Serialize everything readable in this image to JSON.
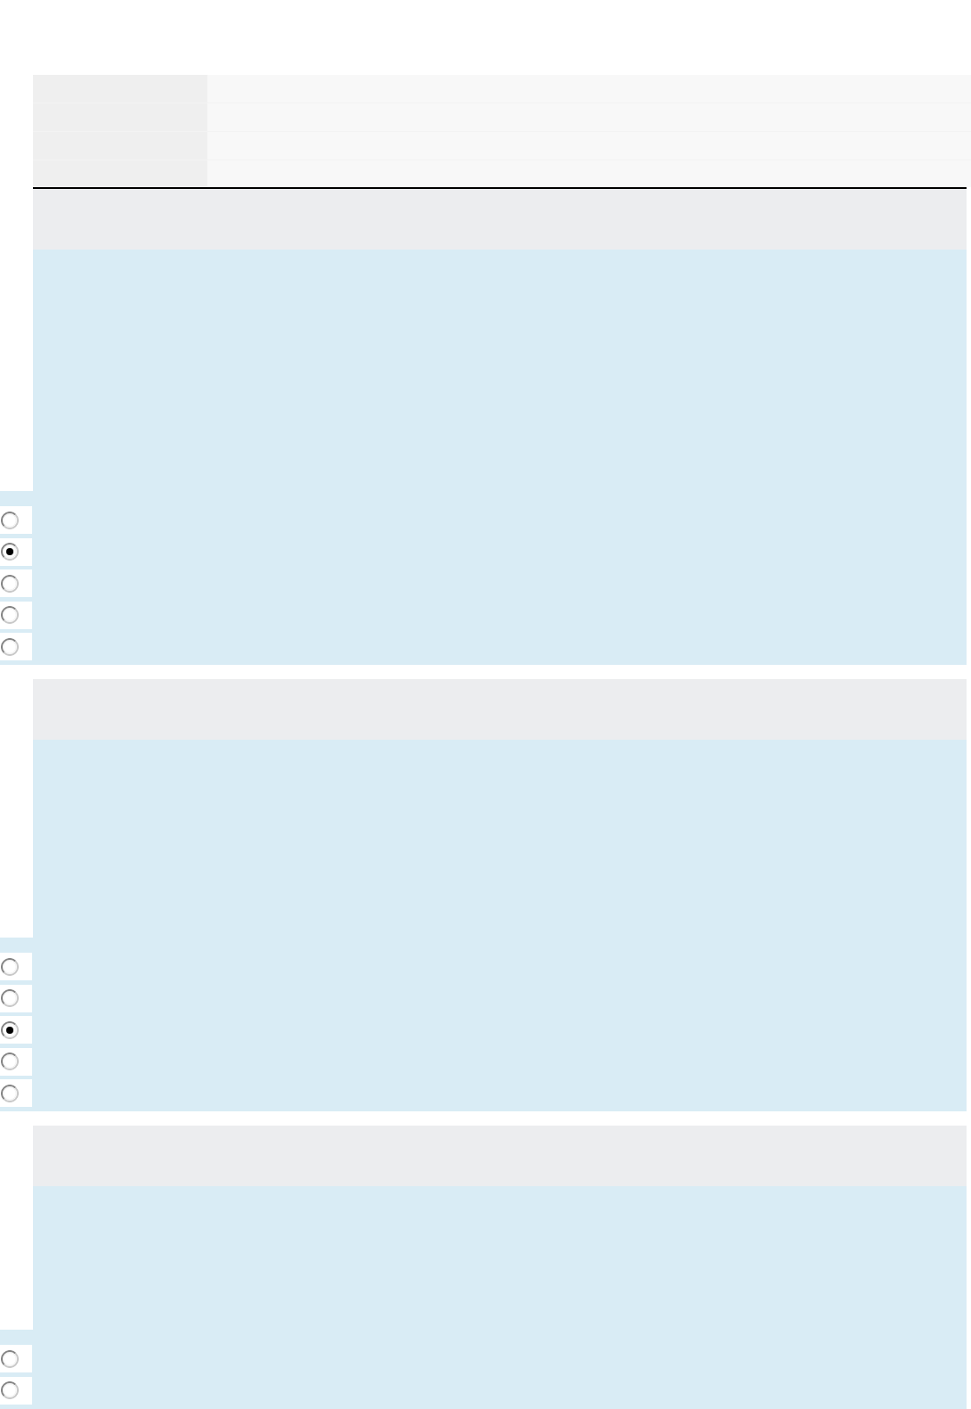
{
  "summary_table": {
    "rows": [
      {},
      {},
      {},
      {}
    ]
  },
  "questions": [
    {
      "options": [
        {
          "selected": false
        },
        {
          "selected": true
        },
        {
          "selected": false
        },
        {
          "selected": false
        },
        {
          "selected": false
        }
      ]
    },
    {
      "options": [
        {
          "selected": false
        },
        {
          "selected": false
        },
        {
          "selected": true
        },
        {
          "selected": false
        },
        {
          "selected": false
        }
      ]
    },
    {
      "options": [
        {
          "selected": false
        },
        {
          "selected": false
        }
      ]
    }
  ]
}
